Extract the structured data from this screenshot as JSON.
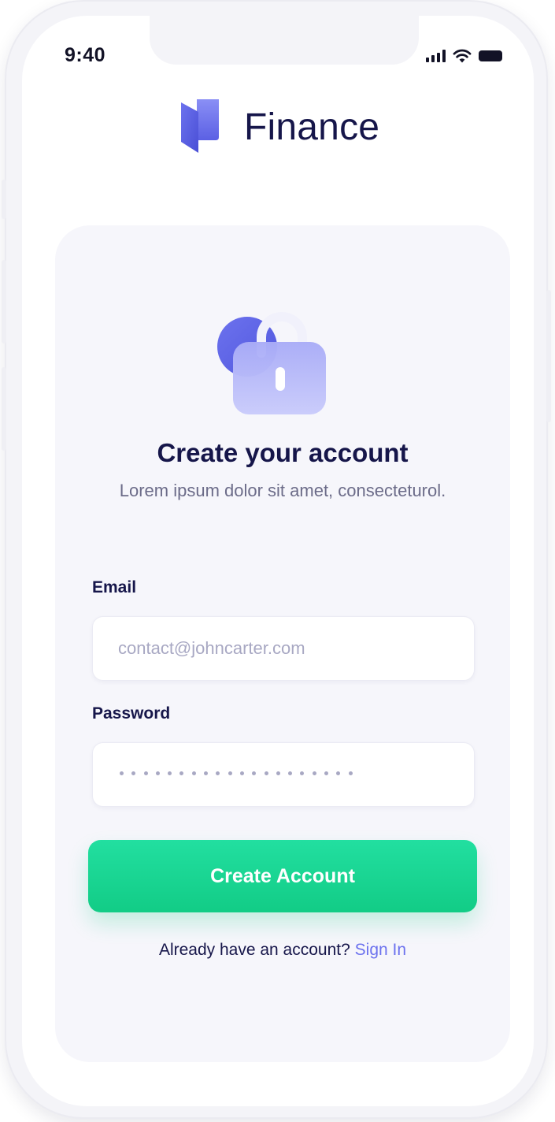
{
  "status_bar": {
    "time": "9:40",
    "icons": [
      "cellular-signal-icon",
      "wifi-icon",
      "battery-icon"
    ]
  },
  "brand": {
    "name": "Finance",
    "logo_icon": "finance-logo-icon"
  },
  "hero": {
    "illustration_icon": "padlock-icon",
    "title": "Create your account",
    "subtitle": "Lorem ipsum dolor sit amet, consecteturol."
  },
  "form": {
    "email_label": "Email",
    "email_placeholder": "contact@johncarter.com",
    "password_label": "Password",
    "password_mask": "••••••••••••••••••••",
    "submit_label": "Create Account"
  },
  "footer": {
    "prompt": "Already have an account?",
    "link_label": "Sign In"
  },
  "colors": {
    "brand_navy": "#16164a",
    "accent_purple": "#6c72ee",
    "cta_green": "#12cc86",
    "muted_text": "#6c6c89",
    "placeholder": "#a8a8c3",
    "card_bg": "#f6f6fb"
  }
}
